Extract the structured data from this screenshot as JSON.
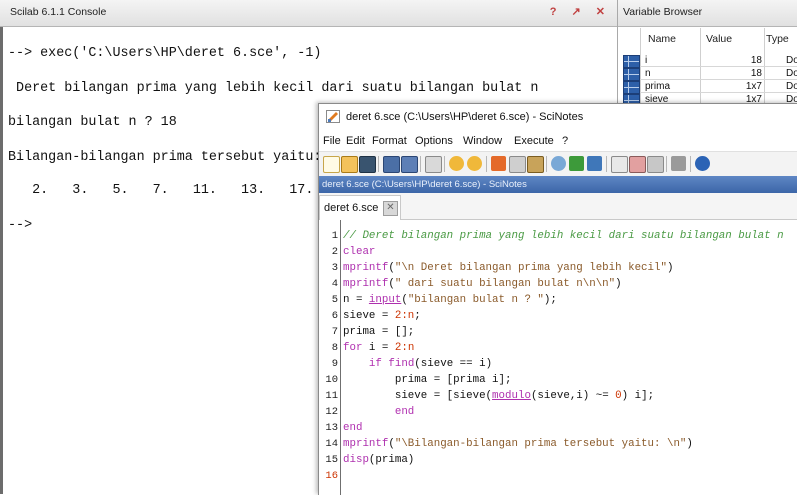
{
  "console": {
    "title": "Scilab 6.1.1 Console",
    "controls": "? ↗ ✕",
    "lines": [
      "--> exec('C:\\Users\\HP\\deret 6.sce', -1)",
      " Deret bilangan prima yang lebih kecil dari suatu bilangan bulat n",
      "bilangan bulat n ? 18",
      "Bilangan-bilangan prima tersebut yaitu:",
      "   2.   3.   5.   7.   11.   13.   17.",
      "-->"
    ]
  },
  "variable_browser": {
    "title": "Variable Browser",
    "headers": [
      "Name",
      "Value",
      "Type"
    ],
    "rows": [
      {
        "name": "i",
        "value": "18",
        "type": "Do"
      },
      {
        "name": "n",
        "value": "18",
        "type": "Do"
      },
      {
        "name": "prima",
        "value": "1x7",
        "type": "Do"
      },
      {
        "name": "sieve",
        "value": "1x7",
        "type": "Do"
      }
    ]
  },
  "scinotes": {
    "title": "deret 6.sce (C:\\Users\\HP\\deret 6.sce) - SciNotes",
    "menu": [
      "File",
      "Edit",
      "Format",
      "Options",
      "Window",
      "Execute",
      "?"
    ],
    "path": "deret 6.sce (C:\\Users\\HP\\deret 6.sce) - SciNotes",
    "tab_label": "deret 6.sce",
    "current_line": "16",
    "line_numbers": [
      "1",
      "2",
      "3",
      "4",
      "5",
      "6",
      "7",
      "8",
      "9",
      "10",
      "11",
      "12",
      "13",
      "14",
      "15",
      "16"
    ],
    "code": {
      "l1": "// Deret bilangan prima yang lebih kecil dari suatu bilangan bulat n",
      "l2": "clear",
      "l3_fn": "mprintf",
      "l3_str": "\"\\n Deret bilangan prima yang lebih kecil\"",
      "l4_fn": "mprintf",
      "l4_str": "\" dari suatu bilangan bulat n\\n\\n\"",
      "l5_a": "n = ",
      "l5_fn": "input",
      "l5_str": "\"bilangan bulat n ? \"",
      "l6_a": "sieve = ",
      "l6_num": "2:n",
      "l7": "prima = [];",
      "l8_kw": "for",
      "l8_a": " i = ",
      "l8_num": "2:n",
      "l9_kw": "if",
      "l9_fn": "find",
      "l9_a": "(sieve == i)",
      "l10": "prima = [prima i];",
      "l11_a": "sieve = [sieve(",
      "l11_fn": "modulo",
      "l11_b": "(sieve,i) ~= ",
      "l11_num": "0",
      "l11_c": ") i];",
      "l12_kw": "end",
      "l13_kw": "end",
      "l14_fn": "mprintf",
      "l14_str": "\"\\Bilangan-bilangan prima tersebut yaitu: \\n\"",
      "l15_fn": "disp",
      "l15_a": "(prima)"
    }
  },
  "colors": {
    "path_bar": "#3c66a8",
    "comment": "#4a9a44",
    "function": "#ae2fae",
    "string": "#8a5a2a",
    "number": "#cc3300"
  },
  "icons": [
    "scinotes-app-icon",
    "new-file-icon",
    "open-file-icon",
    "open-folder-icon",
    "save-icon",
    "save-as-icon",
    "print-icon",
    "undo-icon",
    "redo-icon",
    "cut-icon",
    "copy-icon",
    "paste-icon",
    "execute-file-icon",
    "execute-icon",
    "execute-save-icon",
    "run-icon",
    "run-selection-icon",
    "find-icon",
    "close-tools-icon",
    "help-icon",
    "close-tab-icon",
    "variable-icon"
  ]
}
